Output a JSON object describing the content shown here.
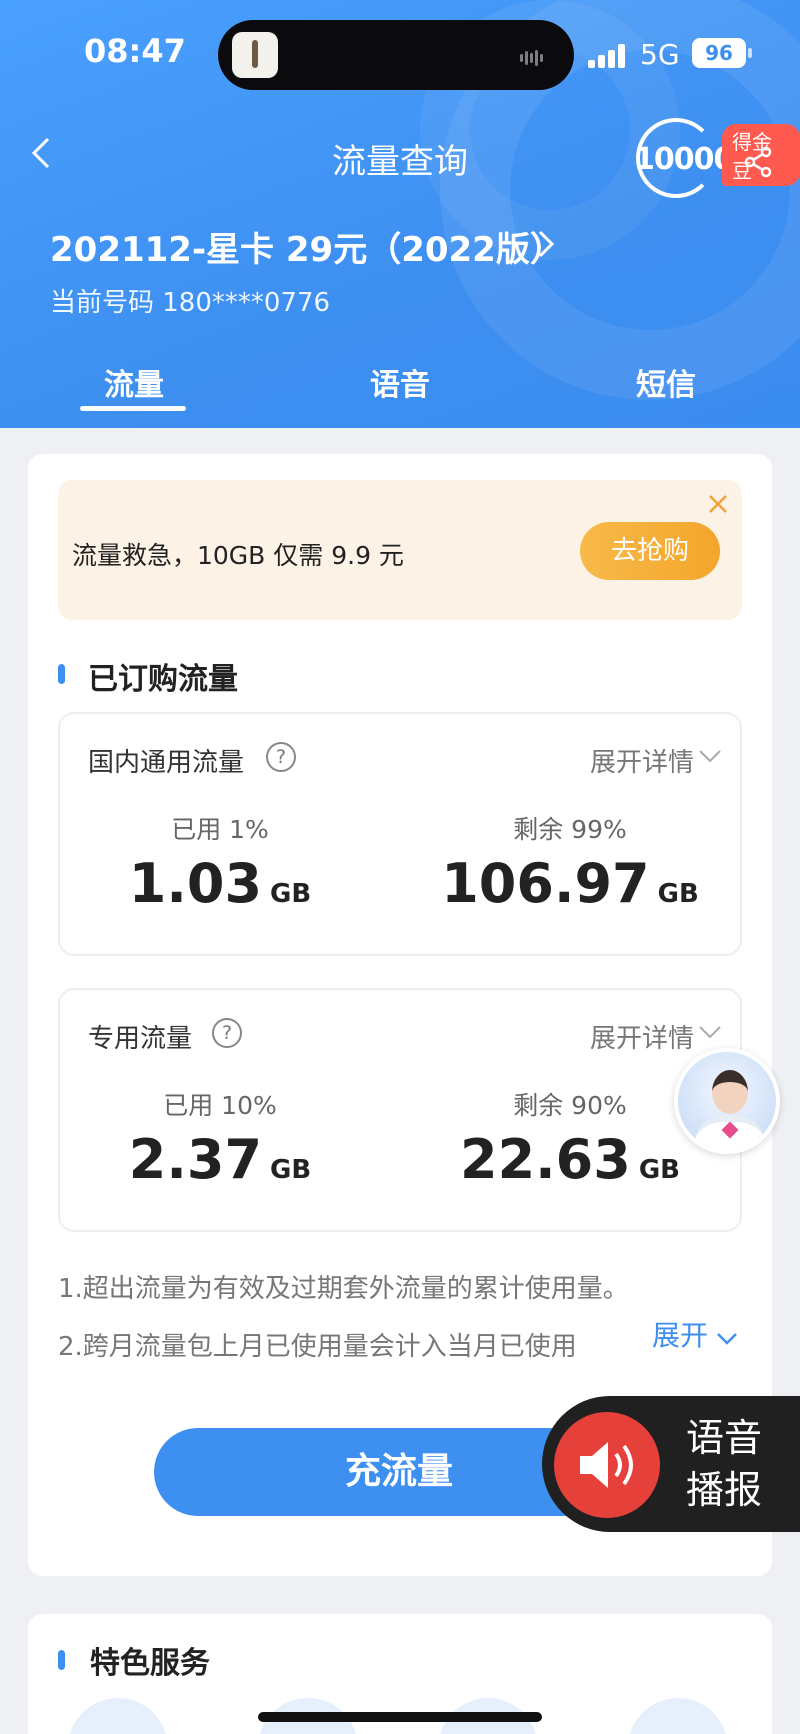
{
  "status": {
    "time": "08:47",
    "network": "5G",
    "battery": "96"
  },
  "nav": {
    "title": "流量查询",
    "logo_text": "10000",
    "badge": "得金豆"
  },
  "plan": {
    "name": "202112-星卡 29元（2022版）",
    "number": "当前号码 180****0776"
  },
  "tabs": [
    {
      "label": "流量"
    },
    {
      "label": "语音"
    },
    {
      "label": "短信"
    }
  ],
  "promo": {
    "text": "流量救急，10GB 仅需 9.9 元",
    "button": "去抢购"
  },
  "subscribed": {
    "title": "已订购流量",
    "groups": [
      {
        "label": "国内通用流量",
        "help": "?",
        "expand": "展开详情",
        "used_label": "已用 1%",
        "used_value": "1.03",
        "used_unit": "GB",
        "left_label": "剩余 99%",
        "left_value": "106.97",
        "left_unit": "GB"
      },
      {
        "label": "专用流量",
        "help": "?",
        "expand": "展开详情",
        "used_label": "已用 10%",
        "used_value": "2.37",
        "used_unit": "GB",
        "left_label": "剩余 90%",
        "left_value": "22.63",
        "left_unit": "GB"
      }
    ]
  },
  "notes": {
    "line1": "1.超出流量为有效及过期套外流量的累计使用量。",
    "line2": "2.跨月流量包上月已使用量会计入当月已使用",
    "expand": "展开"
  },
  "recharge": {
    "label": "充流量"
  },
  "voice": {
    "line1": "语音",
    "line2": "播报"
  },
  "services": {
    "title": "特色服务"
  },
  "colors": {
    "primary": "#3d8ff0",
    "promo_bg": "#fdf2e6",
    "promo_btn": "#f4a52b",
    "voice_red": "#e5413a"
  }
}
